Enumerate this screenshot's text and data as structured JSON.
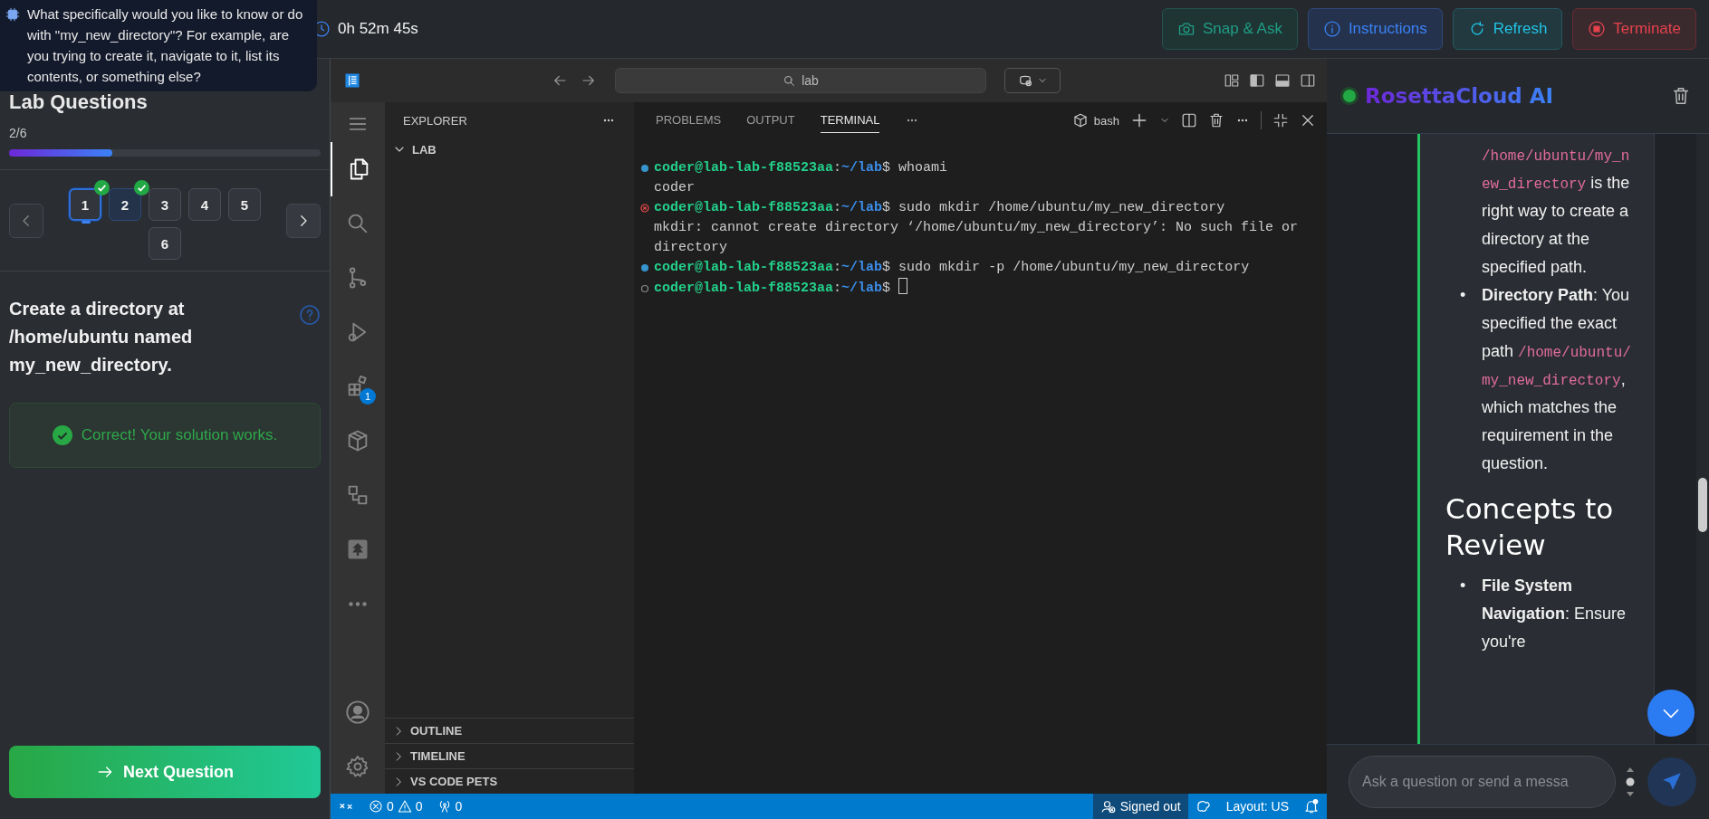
{
  "tooltip": {
    "text": "What specifically would you like to know or do with \"my_new_directory\"? For example, are you trying to create it, navigate to it, list its contents, or something else?"
  },
  "topbar": {
    "timer": "0h 52m 45s",
    "buttons": [
      {
        "label": "Snap & Ask",
        "kind": "snap"
      },
      {
        "label": "Instructions",
        "kind": "info"
      },
      {
        "label": "Refresh",
        "kind": "refresh"
      },
      {
        "label": "Terminate",
        "kind": "terminate"
      }
    ]
  },
  "questions": {
    "heading": "Lab Questions",
    "count": "2/6",
    "level": 0.33,
    "pages": [
      {
        "label": "1",
        "selected": true,
        "completed": true,
        "current": false
      },
      {
        "label": "2",
        "selected": false,
        "completed": true,
        "current": true
      },
      {
        "label": "3",
        "selected": false,
        "completed": false,
        "current": false
      },
      {
        "label": "4",
        "selected": false,
        "completed": false,
        "current": false
      },
      {
        "label": "5",
        "selected": false,
        "completed": false,
        "current": false
      },
      {
        "label": "6",
        "selected": false,
        "completed": false,
        "current": false
      }
    ],
    "prompt": "Create a directory at /home/ubuntu named my_new_directory.",
    "result": "Correct! Your solution works.",
    "next_button": "Next Question"
  },
  "editor": {
    "search": "lab",
    "activity": [
      {
        "kind": "menu",
        "selected": false
      },
      {
        "kind": "files",
        "selected": true
      },
      {
        "kind": "search",
        "selected": false
      },
      {
        "kind": "source",
        "selected": false
      },
      {
        "kind": "debug",
        "selected": false
      },
      {
        "kind": "extensions",
        "selected": false,
        "badge": "1"
      },
      {
        "kind": "box",
        "selected": false
      },
      {
        "kind": "remote",
        "selected": false
      },
      {
        "kind": "logo",
        "selected": false
      },
      {
        "kind": "more",
        "selected": false
      }
    ],
    "explorer": {
      "title": "EXPLORER",
      "folder": "LAB",
      "sections": [
        "OUTLINE",
        "TIMELINE",
        "VS CODE PETS"
      ]
    },
    "panel_tabs": [
      {
        "label": "PROBLEMS",
        "selected": false
      },
      {
        "label": "OUTPUT",
        "selected": false
      },
      {
        "label": "TERMINAL",
        "selected": true
      }
    ],
    "shell": "bash",
    "terminal": [
      {
        "kind": "succeeded",
        "user": "coder@lab-lab-f88523aa",
        "separator": ":",
        "path": "~/lab",
        "symbol": "$",
        "command": "whoami"
      },
      {
        "kind": "output",
        "text": "coder"
      },
      {
        "kind": "failed",
        "user": "coder@lab-lab-f88523aa",
        "separator": ":",
        "path": "~/lab",
        "symbol": "$",
        "command": "sudo mkdir /home/ubuntu/my_new_directory"
      },
      {
        "kind": "output",
        "text": "mkdir: cannot create directory ‘/home/ubuntu/my_new_directory’: No such file or directory"
      },
      {
        "kind": "succeeded",
        "user": "coder@lab-lab-f88523aa",
        "separator": ":",
        "path": "~/lab",
        "symbol": "$",
        "command": "sudo mkdir -p /home/ubuntu/my_new_directory"
      },
      {
        "kind": "pending",
        "user": "coder@lab-lab-f88523aa",
        "separator": ":",
        "path": "~/lab",
        "symbol": "$",
        "cursor": true
      }
    ],
    "status_bar": {
      "errors": "0",
      "warnings": "0",
      "ports": "0",
      "account": "Signed out",
      "layout": "Layout: US"
    }
  },
  "chat": {
    "title": "RosettaCloud AI",
    "online": true,
    "blocks": [
      {
        "kind": "continuation",
        "parts": [
          {
            "kind": "code",
            "text": "/home/ubuntu/my_new_directory"
          },
          {
            "kind": "text",
            "text": " is the right way to create a directory at the specified path."
          }
        ]
      },
      {
        "kind": "item",
        "bullet": "•",
        "parts": [
          {
            "kind": "bold",
            "text": "Directory Path"
          },
          {
            "kind": "text",
            "text": ": You specified the exact path "
          },
          {
            "kind": "code",
            "text": "/home/ubuntu/my_new_directory"
          },
          {
            "kind": "text",
            "text": ", which matches the requirement in the question."
          }
        ]
      },
      {
        "kind": "heading",
        "text": "Concepts to Review"
      },
      {
        "kind": "item",
        "bullet": "•",
        "parts": [
          {
            "kind": "bold",
            "text": "File System Navigation"
          },
          {
            "kind": "text",
            "text": ": Ensure you're"
          }
        ]
      }
    ],
    "placeholder": "Ask a question or send a messa"
  }
}
